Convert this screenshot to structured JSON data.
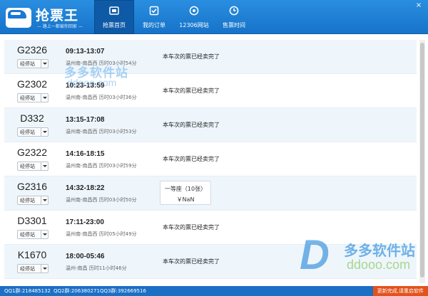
{
  "app": {
    "title": "抢票王",
    "subtitle": "— 路上一都被你回家 —"
  },
  "nav": [
    {
      "label": "抢票首页",
      "icon": "home-icon",
      "active": true
    },
    {
      "label": "我的订单",
      "icon": "checkbox-icon",
      "active": false
    },
    {
      "label": "12306网站",
      "icon": "globe-icon",
      "active": false
    },
    {
      "label": "售票时间",
      "icon": "clock-icon",
      "active": false
    }
  ],
  "window": {
    "close": "×"
  },
  "stop_button_label": "经停站",
  "trains": [
    {
      "number": "G2326",
      "time": "09:13-13:07",
      "route": "温州南-南昌西",
      "duration": "历时03小时54分",
      "status": "本车次的票已经卖完了"
    },
    {
      "number": "G2302",
      "time": "10:23-13:59",
      "route": "温州南-南昌西",
      "duration": "历时03小时36分",
      "status": "本车次的票已经卖完了"
    },
    {
      "number": "D332",
      "time": "13:15-17:08",
      "route": "温州南-南昌西",
      "duration": "历时03小时53分",
      "status": "本车次的票已经卖完了"
    },
    {
      "number": "G2322",
      "time": "14:16-18:15",
      "route": "温州南-南昌西",
      "duration": "历时03小时59分",
      "status": "本车次的票已经卖完了"
    },
    {
      "number": "G2316",
      "time": "14:32-18:22",
      "route": "温州南-南昌西",
      "duration": "历时03小时50分",
      "seat": {
        "name": "一等座",
        "count": "（10张）",
        "price": "￥NaN"
      }
    },
    {
      "number": "D3301",
      "time": "17:11-23:00",
      "route": "温州南-南昌西",
      "duration": "历时05小时49分",
      "status": "本车次的票已经卖完了"
    },
    {
      "number": "K1670",
      "time": "18:00-05:46",
      "route": "温州-南昌",
      "duration": "历时11小时46分",
      "status": "本车次的票已经卖完了"
    }
  ],
  "watermark": {
    "top_text": "多多软件站",
    "top_domain": "ddooo.com",
    "bottom_letter": "D",
    "bottom_text": "多多软件站",
    "bottom_domain": "ddooo.com"
  },
  "statusbar": {
    "qq1": "QQ1群:218485132",
    "qq2": "QQ2群:206380271",
    "qq3": "QQ3群:392669516",
    "update": "更新完成,请重启软件"
  },
  "colors": {
    "titlebar": "#1b79d3",
    "nav_active": "#0e5aa6",
    "row_alt": "#eef6fc",
    "statusbar": "#1b6fc5",
    "update_badge": "#e2521c"
  }
}
